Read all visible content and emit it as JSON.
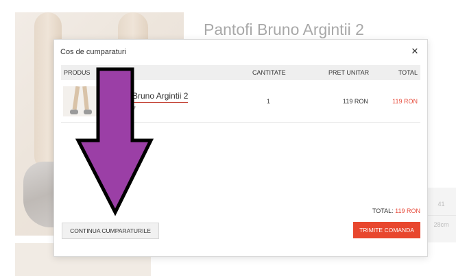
{
  "background": {
    "product_title": "Pantofi Bruno Argintii 2",
    "size_table": [
      "41",
      "28cm"
    ]
  },
  "modal": {
    "title": "Cos de cumparaturi",
    "close_icon": "close-icon",
    "columns": {
      "product": "PRODUS",
      "quantity": "CANTITATE",
      "unit_price": "PRET UNITAR",
      "total": "TOTAL"
    },
    "items": [
      {
        "name": "Bruno Argintii 2",
        "sub": "7",
        "quantity": "1",
        "unit_price": "119 RON",
        "total": "119 RON"
      }
    ],
    "total_label": "TOTAL:",
    "total_value": "119 RON",
    "continue_label": "CONTINUA CUMPARATURILE",
    "order_label": "TRIMITE COMANDA"
  },
  "colors": {
    "accent": "#e8472e",
    "price_red": "#e74c3c",
    "arrow_fill": "#9b3fa6"
  }
}
